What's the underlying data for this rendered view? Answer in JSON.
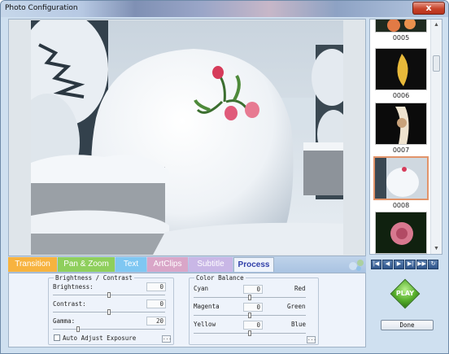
{
  "window": {
    "title": "Photo Configuration",
    "close_glyph": "x"
  },
  "thumbnails": [
    {
      "number": "0005",
      "selected": false
    },
    {
      "number": "0006",
      "selected": false
    },
    {
      "number": "0007",
      "selected": false
    },
    {
      "number": "0008",
      "selected": true
    },
    {
      "number": "",
      "selected": false
    }
  ],
  "nav_buttons": [
    "first-icon",
    "prev-icon",
    "play-icon",
    "next-icon",
    "last-icon",
    "refresh-icon"
  ],
  "tabs": [
    {
      "label": "Transition",
      "color": "#f7b33f"
    },
    {
      "label": "Pan & Zoom",
      "color": "#8fcf5d"
    },
    {
      "label": "Text",
      "color": "#7fc7f2"
    },
    {
      "label": "ArtClips",
      "color": "#d9a6c8"
    },
    {
      "label": "Subtitle",
      "color": "#c9b7e6"
    },
    {
      "label": "Process",
      "color": "#eef3fb",
      "active": true
    }
  ],
  "brightness_contrast": {
    "title": "Brightness / Contrast",
    "brightness": {
      "label": "Brightness:",
      "value": "0"
    },
    "contrast": {
      "label": "Contrast:",
      "value": "0"
    },
    "gamma": {
      "label": "Gamma:",
      "value": "20"
    },
    "auto_adjust": {
      "label": "Auto Adjust Exposure",
      "checked": false
    },
    "more_button": "..."
  },
  "color_balance": {
    "title": "Color Balance",
    "cyan": {
      "label": "Cyan",
      "value": "0",
      "right_label": "Red"
    },
    "magenta": {
      "label": "Magenta",
      "value": "0",
      "right_label": "Green"
    },
    "yellow": {
      "label": "Yellow",
      "value": "0",
      "right_label": "Blue"
    },
    "more_button": "..."
  },
  "play_button": "PLAY",
  "done_button": "Done",
  "colors": {
    "accent": "#2f3fa8",
    "play_green": "#58b02c",
    "selected_border": "#e2946a"
  }
}
